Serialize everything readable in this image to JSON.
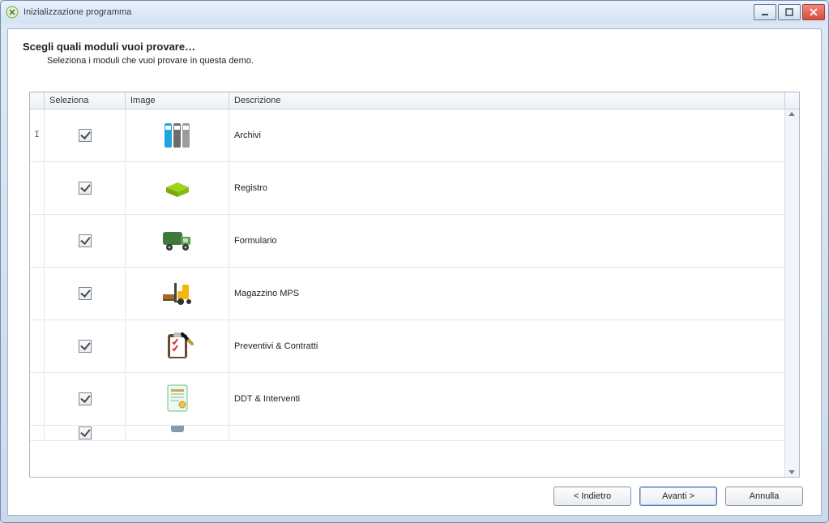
{
  "window": {
    "title": "Inizializzazione programma"
  },
  "header": {
    "title": "Scegli quali moduli vuoi provare…",
    "subtitle": "Seleziona i moduli che vuoi provare in questa demo."
  },
  "grid": {
    "columns": {
      "seleziona": "Seleziona",
      "image": "Image",
      "descrizione": "Descrizione"
    },
    "rows": [
      {
        "checked": true,
        "icon": "binders",
        "descrizione": "Archivi",
        "current": true
      },
      {
        "checked": true,
        "icon": "book",
        "descrizione": "Registro",
        "current": false
      },
      {
        "checked": true,
        "icon": "truck",
        "descrizione": "Formulario",
        "current": false
      },
      {
        "checked": true,
        "icon": "forklift",
        "descrizione": "Magazzino MPS",
        "current": false
      },
      {
        "checked": true,
        "icon": "clipboard",
        "descrizione": "Preventivi & Contratti",
        "current": false
      },
      {
        "checked": true,
        "icon": "document",
        "descrizione": "DDT & Interventi",
        "current": false
      },
      {
        "checked": true,
        "icon": "device",
        "descrizione": "",
        "current": false
      }
    ]
  },
  "buttons": {
    "back": "< Indietro",
    "next": "Avanti >",
    "cancel": "Annulla"
  }
}
